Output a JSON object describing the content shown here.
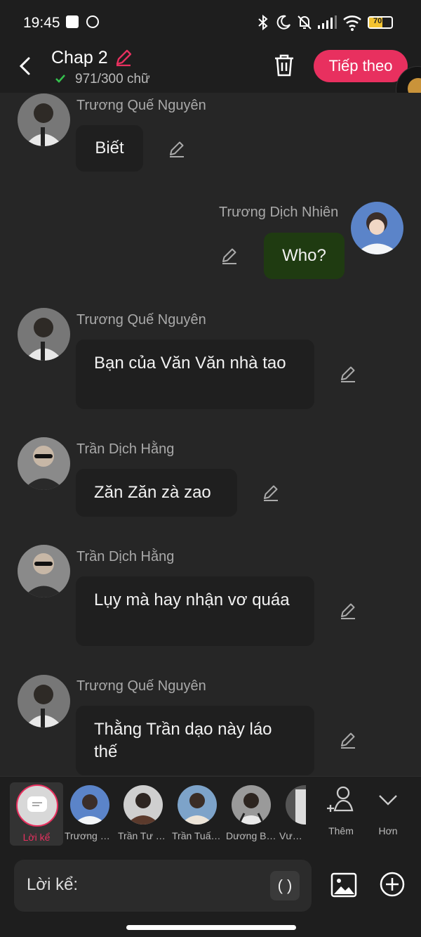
{
  "status": {
    "time": "19:45",
    "battery": "70"
  },
  "header": {
    "title": "Chap 2",
    "word_count": "971/300 chữ",
    "next_label": "Tiếp theo"
  },
  "messages": [
    {
      "side": "left",
      "name": "Trương Quế Nguyên",
      "text": "Biết"
    },
    {
      "side": "right",
      "name": "Trương Dịch Nhiên",
      "text": "Who?"
    },
    {
      "side": "left",
      "name": "Trương Quế Nguyên",
      "text": "Bạn của Văn Văn nhà tao"
    },
    {
      "side": "left",
      "name": "Trần Dịch Hằng",
      "text": "Zăn Zăn zà zao"
    },
    {
      "side": "left",
      "name": "Trần Dịch Hằng",
      "text": "Lụy mà hay nhận vơ quáa"
    },
    {
      "side": "left",
      "name": "Trương Quế Nguyên",
      "text": "Thằng Trần dạo này láo thế"
    }
  ],
  "characters": [
    {
      "label": "Lời kể",
      "selected": true
    },
    {
      "label": "Trương Dị..."
    },
    {
      "label": "Trần Tư H..."
    },
    {
      "label": "Trần Tuấn..."
    },
    {
      "label": "Dương Bá..."
    },
    {
      "label": "Vương"
    }
  ],
  "actions": {
    "more_label": "Thêm",
    "expand_label": "Hơn"
  },
  "input": {
    "prefix": "Lời kể:",
    "paren": "( )"
  },
  "colors": {
    "accent": "#e8305f",
    "right_bubble": "#1f3b11",
    "bubble": "#1f1f1f"
  }
}
